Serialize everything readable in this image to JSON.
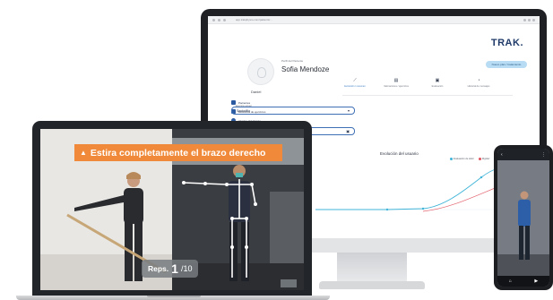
{
  "desktop": {
    "url": "app.trakphysio.com/patients/...",
    "brand": "TRAK.",
    "header_button": "Nuevo plan / tratamiento",
    "profile": {
      "label": "Perfil del Paciente",
      "name": "Sofia Mendoze",
      "avatar_caption": "Daniel"
    },
    "nav": [
      {
        "label": "Pacientes",
        "icon": "user-icon"
      },
      {
        "label": "Biblioteca de ejercicios",
        "icon": "book-icon"
      },
      {
        "label": "Ajustes / Ventanas",
        "icon": "settings-icon"
      }
    ],
    "tabs": [
      {
        "label": "Evolución / resumen",
        "icon": "trend-icon",
        "active": true
      },
      {
        "label": "Valoraciones / ejercicios",
        "icon": "clipboard-icon",
        "active": false
      },
      {
        "label": "Evaluación",
        "icon": "calendar-icon",
        "active": false
      },
      {
        "label": "Historial de mensajes",
        "icon": "history-icon",
        "active": false
      }
    ],
    "select_field": {
      "caption": "Ejercicio actual",
      "value": "Sentadilla"
    },
    "date_field": {
      "caption": "Fecha de inicio"
    },
    "chart_title": "Evolución del usuario",
    "legend": [
      {
        "label": "Evaluación de dolor",
        "color": "#3fb4d8"
      },
      {
        "label": "Rigidez",
        "color": "#e0515e"
      },
      {
        "label": "Movilidad",
        "color": "#f0b43a"
      }
    ],
    "colors": {
      "brand": "#1f3a68",
      "accent": "#3e6fb5",
      "line_primary": "#3fb4d8",
      "line_secondary": "#e0515e"
    }
  },
  "laptop": {
    "hint_icon": "warning-triangle-icon",
    "hint": "Estira completamente el brazo derecho",
    "reps_label": "Reps.",
    "reps_count": "1",
    "reps_total": "/10",
    "colors": {
      "banner": "#f08a3a"
    }
  },
  "phone": {
    "top_left": "‹",
    "top_right": "⋮",
    "bottom_icons": [
      "⌂",
      "▶"
    ]
  }
}
